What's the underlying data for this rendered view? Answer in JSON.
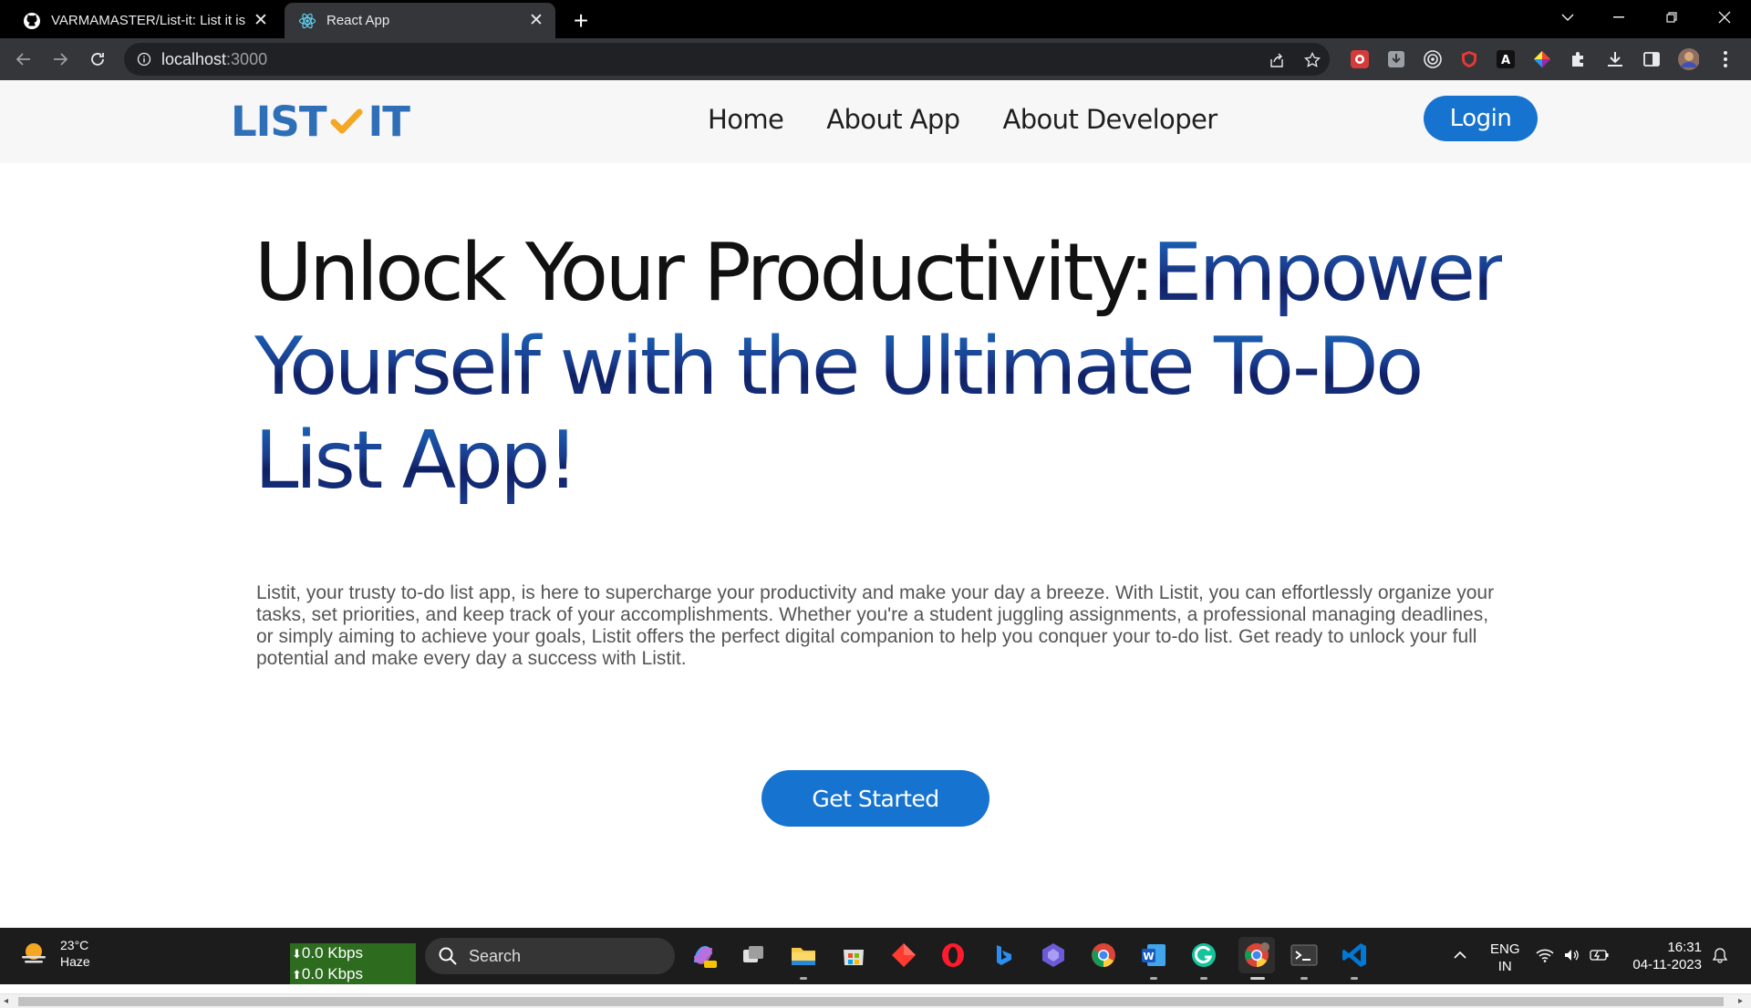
{
  "browser": {
    "tabs": [
      {
        "title": "VARMAMASTER/List-it: List it is a",
        "icon": "github-icon",
        "active": false
      },
      {
        "title": "React App",
        "icon": "react-icon",
        "active": true
      }
    ],
    "url_host": "localhost",
    "url_port": ":3000"
  },
  "nav": {
    "logo_left": "LIST",
    "logo_right": "IT",
    "links": [
      "Home",
      "About App",
      "About Developer"
    ],
    "login_label": "Login"
  },
  "hero": {
    "headline_part1": "Unlock Your Productivity:",
    "headline_part2": "Empower Yourself with the Ultimate To-Do List App!",
    "description": "Listit, your trusty to-do list app, is here to supercharge your productivity and make your day a breeze. With Listit, you can effortlessly organize your tasks, set priorities, and keep track of your accomplishments. Whether you're a student juggling assignments, a professional managing deadlines, or simply aiming to achieve your goals, Listit offers the perfect digital companion to help you conquer your to-do list. Get ready to unlock your full potential and make every day a success with Listit.",
    "cta_label": "Get Started"
  },
  "taskbar": {
    "weather_temp": "23°C",
    "weather_desc": "Haze",
    "net_down": "0.0 Kbps",
    "net_up": "0.0 Kbps",
    "search_label": "Search",
    "lang_top": "ENG",
    "lang_bottom": "IN",
    "time": "16:31",
    "date": "04-11-2023"
  },
  "colors": {
    "accent": "#1773d0",
    "logo_blue": "#2e6fb8",
    "logo_check": "#f5a623",
    "headline_dark_blue": "#0f1f63"
  }
}
